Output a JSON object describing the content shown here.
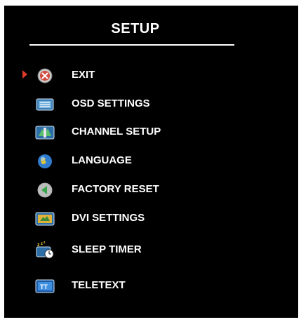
{
  "menu": {
    "title": "SETUP",
    "items": [
      {
        "label": "EXIT",
        "icon": "exit-icon",
        "selected": true
      },
      {
        "label": "OSD SETTINGS",
        "icon": "osd-settings-icon"
      },
      {
        "label": "CHANNEL SETUP",
        "icon": "channel-setup-icon"
      },
      {
        "label": "LANGUAGE",
        "icon": "language-globe-icon"
      },
      {
        "label": "FACTORY RESET",
        "icon": "factory-reset-icon"
      },
      {
        "label": "DVI SETTINGS",
        "icon": "dvi-settings-icon"
      },
      {
        "label": "SLEEP TIMER",
        "icon": "sleep-timer-icon"
      },
      {
        "label": "TELETEXT",
        "icon": "teletext-icon"
      }
    ]
  },
  "colors": {
    "background": "#000000",
    "text": "#ffffff",
    "pointer": "#e03a2a"
  }
}
